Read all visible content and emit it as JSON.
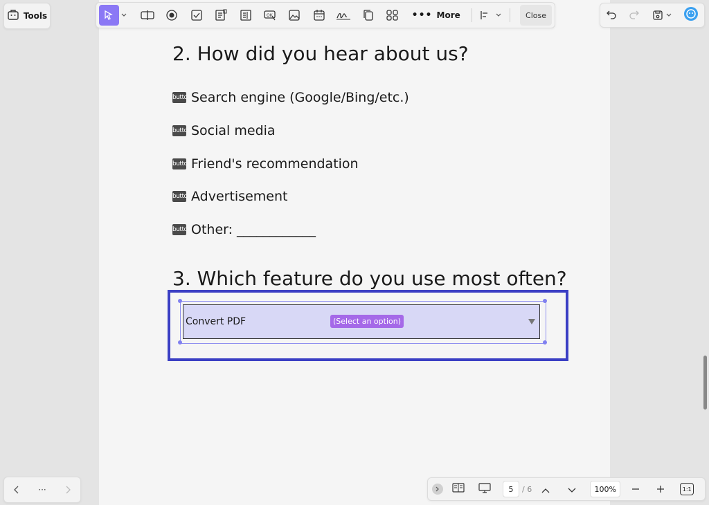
{
  "toolbar": {
    "tools_label": "Tools",
    "more_label": "More",
    "close_label": "Close"
  },
  "document": {
    "q2": {
      "title": "2. How did you hear about us?",
      "radio_placeholder": "button",
      "options": [
        "Search engine (Google/Bing/etc.)",
        "Social media",
        "Friend's recommendation",
        "Advertisement",
        "Other: ____________"
      ]
    },
    "q3": {
      "title": "3. Which feature do you use most often?",
      "combo_value": "Convert PDF",
      "combo_tag": "(Select an option)"
    }
  },
  "bottombar": {
    "current_page": "5",
    "total_pages": "/ 6",
    "zoom": "100%",
    "actual_size": "1:1"
  },
  "nav": {
    "dots": "···"
  },
  "colors": {
    "accent": "#8b78f5",
    "highlight": "#3b3fc4",
    "combo_fill": "#d8d8f6",
    "tag": "#a569e8"
  }
}
